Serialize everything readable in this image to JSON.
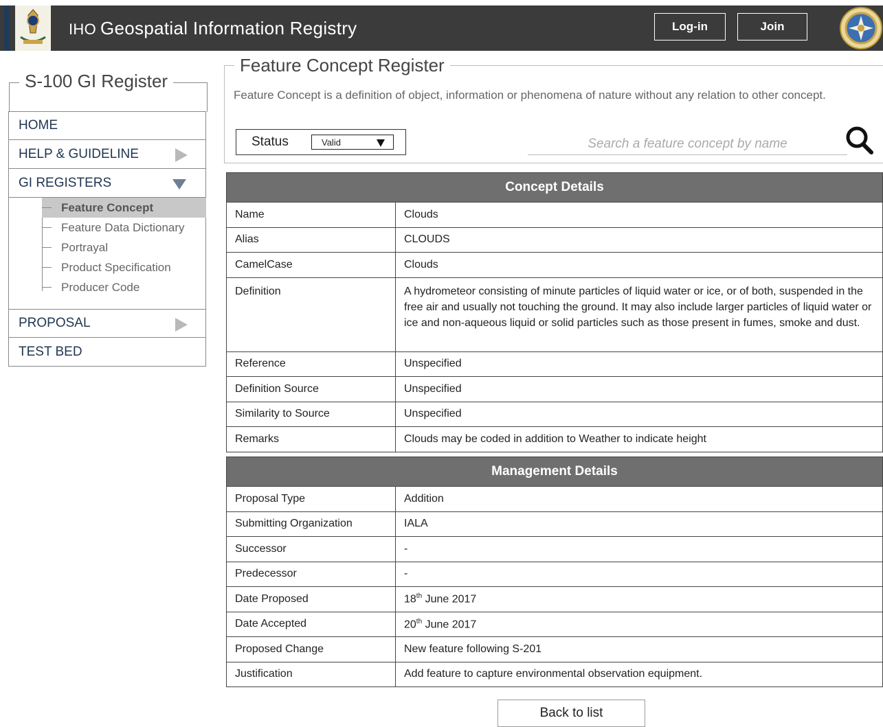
{
  "header": {
    "title_prefix": "IHO",
    "title": "Geospatial Information Registry",
    "login_label": "Log-in",
    "join_label": "Join"
  },
  "sidebar": {
    "title": "S-100 GI Register",
    "items": [
      {
        "label": "HOME"
      },
      {
        "label": "HELP & GUIDELINE"
      },
      {
        "label": "GI REGISTERS"
      },
      {
        "label": "PROPOSAL"
      },
      {
        "label": "TEST BED"
      }
    ],
    "subitems": [
      {
        "label": "Feature Concept"
      },
      {
        "label": "Feature Data Dictionary"
      },
      {
        "label": "Portrayal"
      },
      {
        "label": "Product Specification"
      },
      {
        "label": "Producer Code"
      }
    ]
  },
  "main": {
    "title": "Feature Concept Register",
    "description": "Feature Concept is a definition of object, information or phenomena of nature without any relation to other concept.",
    "status_label": "Status",
    "status_value": "Valid",
    "search_placeholder": "Search a feature concept by name"
  },
  "concept": {
    "heading": "Concept Details",
    "rows": [
      {
        "key": "Name",
        "value": "Clouds"
      },
      {
        "key": "Alias",
        "value": "CLOUDS"
      },
      {
        "key": "CamelCase",
        "value": "Clouds"
      },
      {
        "key": "Definition",
        "value": "A hydrometeor consisting of minute particles of liquid water or ice, or of both, suspended in the free air and usually not touching the ground. It may also include larger particles of liquid water or ice and non-aqueous liquid or solid particles such as those present in fumes, smoke and dust."
      },
      {
        "key": "Reference",
        "value": "Unspecified"
      },
      {
        "key": "Definition Source",
        "value": "Unspecified"
      },
      {
        "key": "Similarity to Source",
        "value": "Unspecified"
      },
      {
        "key": "Remarks",
        "value": "Clouds may be coded in addition to Weather to indicate height"
      }
    ]
  },
  "management": {
    "heading": "Management Details",
    "rows": [
      {
        "key": "Proposal Type",
        "value": "Addition"
      },
      {
        "key": "Submitting Organization",
        "value": "IALA"
      },
      {
        "key": "Successor",
        "value": "-"
      },
      {
        "key": "Predecessor",
        "value": "-"
      },
      {
        "key": "Date Proposed",
        "day": "18",
        "sup": "th",
        "rest": " June 2017"
      },
      {
        "key": "Date Accepted",
        "day": "20",
        "sup": "th",
        "rest": " June 2017"
      },
      {
        "key": "Proposed Change",
        "value": "New feature following S-201"
      },
      {
        "key": "Justification",
        "value": "Add feature to capture environmental observation equipment."
      }
    ]
  },
  "footer": {
    "back_label": "Back to list"
  },
  "colors": {
    "header_bg": "#3b3b3b",
    "table_heading_bg": "#6f6f6f",
    "nav_text": "#1f3550",
    "active_sub_bg": "#c8c8c8"
  },
  "icons": [
    "iho-logo-left",
    "iho-seal-right",
    "search-icon",
    "chevron-right-icon",
    "chevron-down-icon",
    "dropdown-arrow-icon"
  ]
}
